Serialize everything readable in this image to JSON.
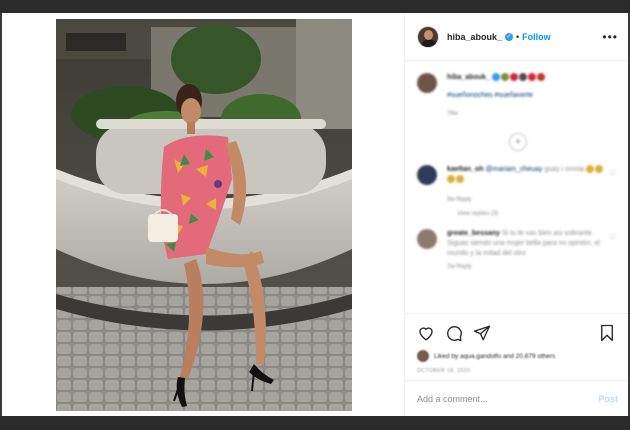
{
  "header": {
    "username": "hiba_abouk_",
    "separator": "•",
    "follow_label": "Follow",
    "more_label": "•••"
  },
  "comments": {
    "caption": {
      "username": "hiba_abouk_",
      "text": "#sueñonoches #sueñaverte",
      "meta": "79w"
    },
    "load_more": "+",
    "items": [
      {
        "username": "kaeltan_oh",
        "mention": "@mariam_cheuay",
        "text": "guay i omnia",
        "meta": "9w   Reply",
        "replies": "View replies (3)"
      },
      {
        "username": "greate_bessany",
        "text": "Si tu te vas bien asi sobrante. Siguas siendo una mujer bella para mi opinión, el mundo y la mitad del otro",
        "meta": "2w   Reply"
      }
    ]
  },
  "actions": {
    "likes_text": "Liked by aqua.gandolfo and 20,879 others",
    "date": "OCTOBER 18, 2020"
  },
  "add_comment": {
    "placeholder": "Add a comment...",
    "post_label": "Post"
  },
  "colors": {
    "accent": "#0095f6",
    "post_disabled": "#b2dffc",
    "verified": "#3897f0"
  },
  "icons": [
    "heart-icon",
    "comment-icon",
    "share-icon",
    "bookmark-icon",
    "more-icon",
    "verified-icon",
    "add-comments-icon"
  ]
}
